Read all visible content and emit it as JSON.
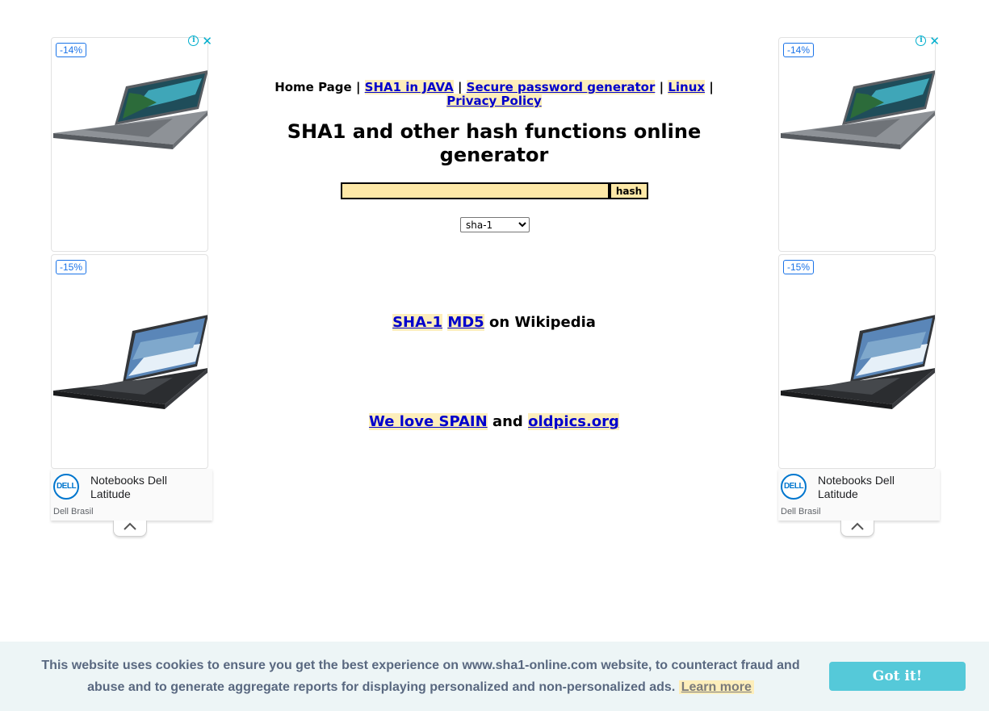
{
  "nav": {
    "home": "Home Page",
    "sep": "|",
    "links": [
      "SHA1 in JAVA",
      "Secure password generator",
      "Linux",
      "Privacy Policy"
    ]
  },
  "title": "SHA1 and other hash functions online generator",
  "form": {
    "input_value": "",
    "button_label": "hash",
    "algorithm_selected": "sha-1"
  },
  "wiki_line": {
    "link1": "SHA-1",
    "link2": "MD5",
    "suffix": "on Wikipedia"
  },
  "spain_line": {
    "link1": "We love SPAIN",
    "middle": "and",
    "link2": "oldpics.org"
  },
  "ads": {
    "discount_top": "-14%",
    "discount_bottom": "-15%",
    "title": "Notebooks Dell Latitude",
    "brand": "Dell Brasil",
    "logo_text": "DELL",
    "info_icon": "info-icon",
    "close_icon": "close-icon",
    "collapse_icon": "chevron-up-icon"
  },
  "cookie": {
    "text": "This website uses cookies to ensure you get the best experience on www.sha1-online.com website, to counteract fraud and abuse and to generate aggregate reports for displaying personalized and non-personalized ads.",
    "learn_more": "Learn more",
    "button": "Got it!"
  },
  "colors": {
    "link": "#0000cc",
    "link_highlight": "#fdeebb",
    "input_bg": "#fde8a7",
    "cookie_bg": "#edf5f6",
    "cookie_button": "#55c9d9",
    "ad_accent": "#00aecd"
  }
}
